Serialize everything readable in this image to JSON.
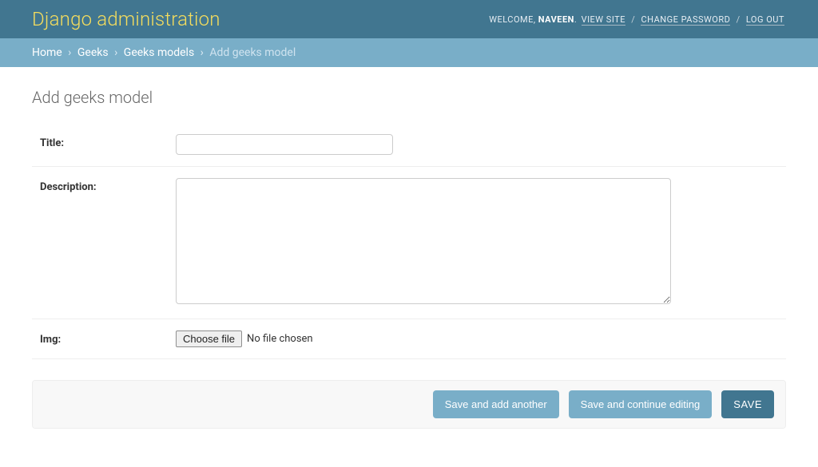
{
  "header": {
    "branding": "Django administration",
    "welcome": "WELCOME, ",
    "username": "NAVEEN",
    "view_site": "VIEW SITE",
    "change_password": "CHANGE PASSWORD",
    "log_out": "LOG OUT",
    "sep_dot": ". ",
    "sep_slash": " / "
  },
  "breadcrumbs": {
    "home": "Home",
    "app": "Geeks",
    "model": "Geeks models",
    "current": "Add geeks model",
    "sep": "›"
  },
  "page": {
    "title": "Add geeks model"
  },
  "form": {
    "title": {
      "label": "Title:",
      "value": ""
    },
    "description": {
      "label": "Description:",
      "value": ""
    },
    "img": {
      "label": "Img:",
      "button": "Choose file",
      "status": "No file chosen"
    }
  },
  "buttons": {
    "save_add_another": "Save and add another",
    "save_continue": "Save and continue editing",
    "save": "SAVE"
  }
}
